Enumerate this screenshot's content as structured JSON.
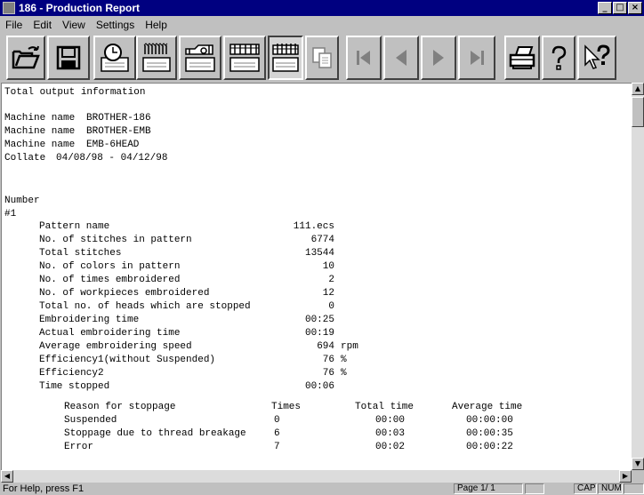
{
  "window": {
    "title": "186 - Production Report",
    "minimize": "_",
    "maximize": "□",
    "close": "×"
  },
  "menu": [
    "File",
    "Edit",
    "View",
    "Settings",
    "Help"
  ],
  "toolbar": {
    "buttons": [
      {
        "name": "open",
        "icon": "folder-open-icon"
      },
      {
        "name": "save",
        "icon": "floppy-disk-icon"
      },
      {
        "name": "time",
        "icon": "clock-icon"
      },
      {
        "name": "stitch-chart",
        "icon": "stitch-chart-icon"
      },
      {
        "name": "machine",
        "icon": "machine-icon"
      },
      {
        "name": "heads",
        "icon": "heads-icon"
      },
      {
        "name": "multi-heads",
        "icon": "multi-heads-icon"
      },
      {
        "name": "copy",
        "icon": "copy-icon"
      },
      {
        "name": "first",
        "icon": "first-page-icon"
      },
      {
        "name": "previous",
        "icon": "previous-page-icon"
      },
      {
        "name": "next",
        "icon": "next-page-icon"
      },
      {
        "name": "last",
        "icon": "last-page-icon"
      },
      {
        "name": "print",
        "icon": "printer-icon"
      },
      {
        "name": "help",
        "icon": "question-icon"
      },
      {
        "name": "context-help",
        "icon": "context-help-icon"
      }
    ]
  },
  "report": {
    "heading": "Total output information",
    "machines": [
      {
        "label": "Machine name",
        "value": "BROTHER-186"
      },
      {
        "label": "Machine name",
        "value": "BROTHER-EMB"
      },
      {
        "label": "Machine name",
        "value": "EMB-6HEAD"
      }
    ],
    "collate_label": "Collate",
    "collate_value": "04/08/98 - 04/12/98",
    "number_label": "Number",
    "number_value": "#1",
    "fields": [
      {
        "label": "Pattern name",
        "value": "111.ecs",
        "unit": ""
      },
      {
        "label": "No. of stitches in pattern",
        "value": "6774",
        "unit": ""
      },
      {
        "label": "Total stitches",
        "value": "13544",
        "unit": ""
      },
      {
        "label": "No. of colors in pattern",
        "value": "10",
        "unit": ""
      },
      {
        "label": "No. of times embroidered",
        "value": "2",
        "unit": ""
      },
      {
        "label": "No. of workpieces embroidered",
        "value": "12",
        "unit": ""
      },
      {
        "label": "Total no. of heads which are stopped",
        "value": "0",
        "unit": ""
      },
      {
        "label": "Embroidering time",
        "value": "00:25",
        "unit": ""
      },
      {
        "label": "Actual embroidering time",
        "value": "00:19",
        "unit": ""
      },
      {
        "label": "Average embroidering speed",
        "value": "694",
        "unit": "rpm"
      },
      {
        "label": "Efficiency1(without Suspended)",
        "value": "76",
        "unit": "%"
      },
      {
        "label": "Efficiency2",
        "value": "76",
        "unit": "%"
      },
      {
        "label": "Time stopped",
        "value": "00:06",
        "unit": ""
      }
    ],
    "stoppage": {
      "headers": [
        "Reason for stoppage",
        "Times",
        "Total time",
        "Average time"
      ],
      "rows": [
        [
          "Suspended",
          "0",
          "00:00",
          "00:00:00"
        ],
        [
          "Stoppage due to thread breakage",
          "6",
          "00:03",
          "00:00:35"
        ],
        [
          "Error",
          "7",
          "00:02",
          "00:00:22"
        ]
      ]
    }
  },
  "status": {
    "help": "For Help, press F1",
    "page": "Page  1/ 1",
    "cap": "CAP",
    "num": "NUM"
  }
}
